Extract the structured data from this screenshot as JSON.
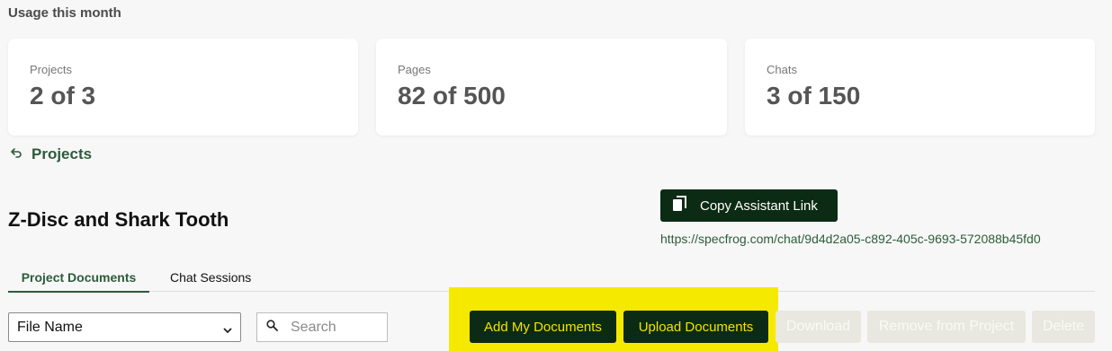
{
  "usage": {
    "heading": "Usage this month",
    "cards": [
      {
        "label": "Projects",
        "value": "2 of 3"
      },
      {
        "label": "Pages",
        "value": "82 of 500"
      },
      {
        "label": "Chats",
        "value": "3 of 150"
      }
    ]
  },
  "nav": {
    "back_label": "Projects"
  },
  "project": {
    "title": "Z-Disc and Shark Tooth",
    "copy_link_label": "Copy Assistant Link",
    "chat_url": "https://specfrog.com/chat/9d4d2a05-c892-405c-9693-572088b45fd0"
  },
  "tabs": [
    {
      "label": "Project Documents",
      "active": true
    },
    {
      "label": "Chat Sessions",
      "active": false
    }
  ],
  "toolbar": {
    "sort_select_value": "File Name",
    "search_placeholder": "Search",
    "add_label": "Add My Documents",
    "upload_label": "Upload Documents",
    "download_label": "Download",
    "remove_label": "Remove from Project",
    "delete_label": "Delete"
  },
  "colors": {
    "brand_dark": "#0c2b14",
    "brand_green": "#2d5b3b",
    "highlight": "#f6e900",
    "button_text": "#f4e100"
  },
  "icons": {
    "back": "back-arrow-icon",
    "copy": "copy-icon",
    "search": "search-icon",
    "select": "chevron-down-icon"
  }
}
